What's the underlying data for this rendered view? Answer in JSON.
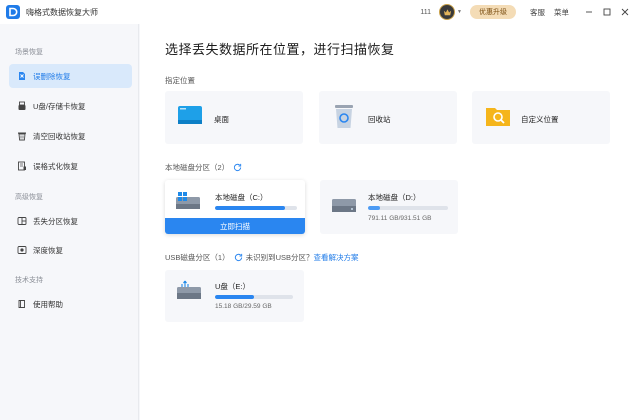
{
  "app": {
    "title": "嗨格式数据恢复大师",
    "user_id": "111",
    "upgrade_label": "优惠升级",
    "service_label": "客服",
    "menu_label": "菜单"
  },
  "sidebar": {
    "sections": [
      {
        "title": "场景恢复",
        "items": [
          {
            "label": "误删除恢复",
            "icon": "file-delete-icon",
            "active": true
          },
          {
            "label": "U盘/存储卡恢复",
            "icon": "usb-drive-icon"
          },
          {
            "label": "清空回收站恢复",
            "icon": "recycle-bin-icon"
          },
          {
            "label": "误格式化恢复",
            "icon": "format-icon"
          }
        ]
      },
      {
        "title": "高级恢复",
        "items": [
          {
            "label": "丢失分区恢复",
            "icon": "partition-icon"
          },
          {
            "label": "深度恢复",
            "icon": "deep-scan-icon"
          }
        ]
      },
      {
        "title": "技术支持",
        "items": [
          {
            "label": "使用帮助",
            "icon": "help-book-icon"
          }
        ]
      }
    ]
  },
  "main": {
    "title": "选择丢失数据所在位置，进行扫描恢复",
    "locations_label": "指定位置",
    "locations": [
      {
        "label": "桌面",
        "icon": "desktop-folder-icon"
      },
      {
        "label": "回收站",
        "icon": "recycle-bin-icon"
      },
      {
        "label": "自定义位置",
        "icon": "search-folder-icon"
      }
    ],
    "local_label": "本地磁盘分区",
    "local_count": "（2）",
    "disks": [
      {
        "name": "本地磁盘（C:）",
        "used_fraction": 0.85,
        "size": "",
        "scan_label": "立即扫描",
        "icon": "windows-drive-icon"
      },
      {
        "name": "本地磁盘（D:）",
        "used_fraction": 0.15,
        "size": "791.11 GB/931.51 GB",
        "icon": "hard-drive-icon"
      }
    ],
    "usb_label": "USB磁盘分区",
    "usb_count": "（1）",
    "usb_hint": "未识别到USB分区？",
    "usb_help_link": "查看解决方案",
    "usb_disks": [
      {
        "name": "U盘（E:）",
        "used_fraction": 0.5,
        "size": "15.18 GB/29.59 GB",
        "icon": "usb-drive-icon"
      }
    ]
  },
  "colors": {
    "accent": "#2a86f0",
    "sidebar_active": "#d9e9fb",
    "upgrade_bg": "#f4dcb6"
  }
}
